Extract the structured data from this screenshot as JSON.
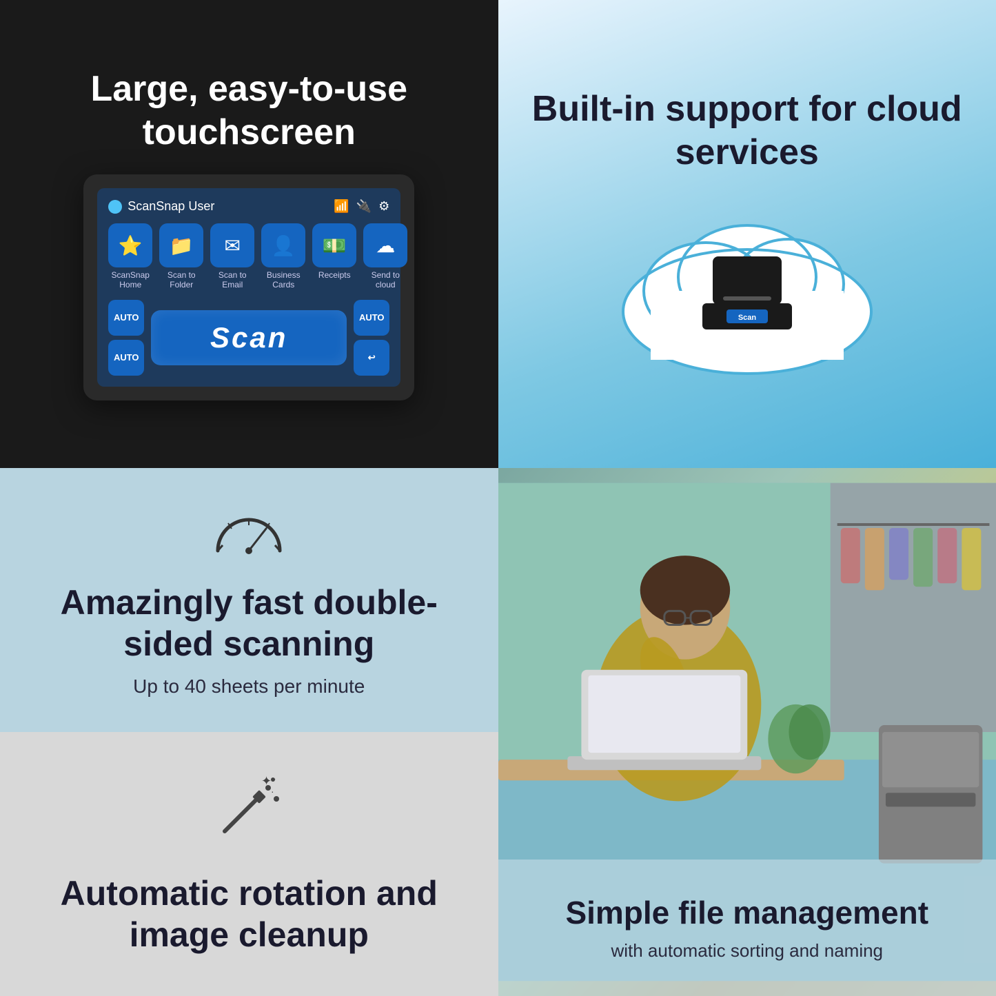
{
  "grid": {
    "topLeft": {
      "title": "Large, easy-to-use\ntouchscreen",
      "screen": {
        "user": "ScanSnap User",
        "apps": [
          {
            "icon": "⭐",
            "label": "ScanSnap\nHome"
          },
          {
            "icon": "📁",
            "label": "Scan to\nFolder"
          },
          {
            "icon": "✉",
            "label": "Scan to\nEmail"
          },
          {
            "icon": "👤",
            "label": "Business\nCards"
          },
          {
            "icon": "💵",
            "label": "Receipts"
          },
          {
            "icon": "☁",
            "label": "Send to\ncloud"
          }
        ],
        "autoLabel": "AUTO",
        "scanLabel": "Scan"
      }
    },
    "topRight": {
      "title": "Built-in support\nfor cloud services",
      "scanButton": "Scan"
    },
    "bottomLeftTop": {
      "title": "Amazingly fast\ndouble-sided scanning",
      "subtitle": "Up to 40 sheets per minute"
    },
    "bottomLeftBottom": {
      "title": "Automatic rotation\nand image cleanup"
    },
    "bottomRight": {
      "title": "Simple file management",
      "subtitle": "with automatic sorting and naming"
    }
  }
}
